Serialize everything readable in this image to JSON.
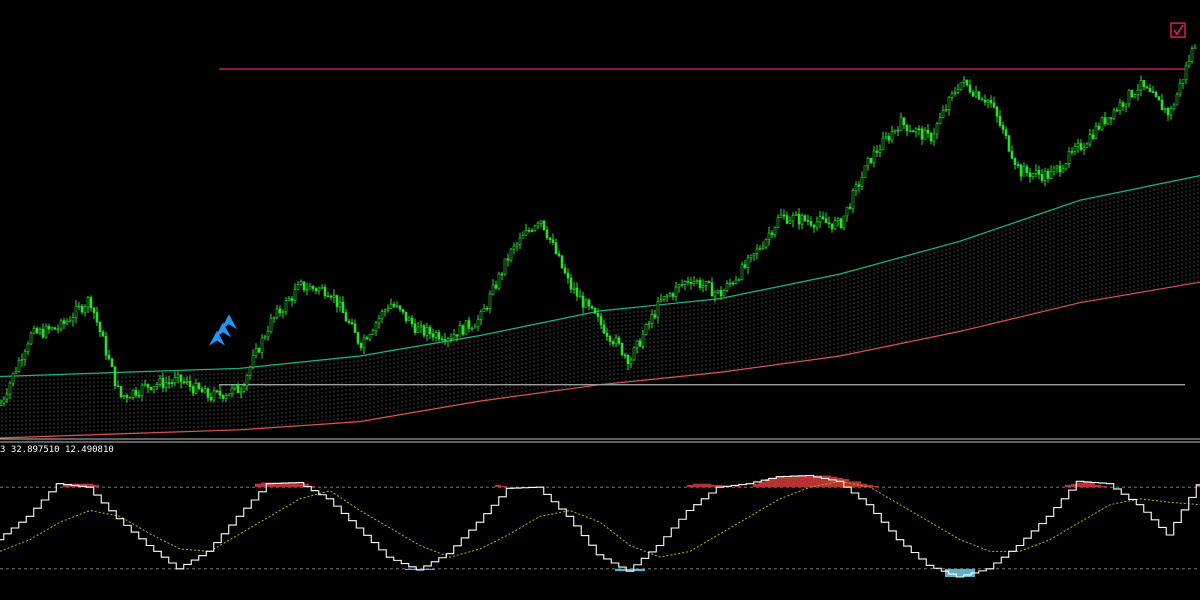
{
  "chart_data": [
    {
      "type": "line",
      "panel": "main",
      "title": "",
      "xlabel": "",
      "ylabel": "",
      "xlim": [
        0,
        200
      ],
      "ylim": [
        0,
        100
      ],
      "grid": false,
      "legend": "none",
      "series": [
        {
          "kind": "price-candles",
          "color": "#2ddc2d",
          "x": [
            0,
            5,
            10,
            15,
            20,
            25,
            30,
            35,
            40,
            45,
            50,
            55,
            60,
            65,
            70,
            75,
            80,
            85,
            90,
            95,
            100,
            105,
            110,
            115,
            120,
            125,
            130,
            135,
            140,
            145,
            150,
            155,
            160,
            165,
            170,
            175,
            180,
            185,
            190,
            195,
            200
          ],
          "y": [
            8,
            25,
            27,
            34,
            10,
            13,
            14,
            10,
            12,
            28,
            37,
            36,
            23,
            33,
            26,
            25,
            29,
            45,
            54,
            37,
            28,
            19,
            33,
            39,
            35,
            43,
            54,
            53,
            52,
            68,
            77,
            73,
            87,
            82,
            65,
            64,
            71,
            79,
            86,
            79,
            100
          ]
        },
        {
          "kind": "upper-band",
          "color": "#1fb27a",
          "x": [
            0,
            20,
            40,
            60,
            80,
            100,
            120,
            140,
            160,
            180,
            200
          ],
          "y": [
            15,
            16,
            17,
            20,
            25,
            31,
            34,
            40,
            48,
            58,
            64
          ]
        },
        {
          "kind": "lower-band",
          "color": "#d9534f",
          "x": [
            0,
            20,
            40,
            60,
            80,
            100,
            120,
            140,
            160,
            180,
            200
          ],
          "y": [
            0,
            1,
            2,
            4,
            9,
            13,
            16,
            20,
            26,
            33,
            38
          ]
        },
        {
          "kind": "resistance-level",
          "color": "#c2185b",
          "x": [
            36.5,
            197.5
          ],
          "y": [
            90,
            90
          ]
        },
        {
          "kind": "support-level",
          "color": "#9e9e9e",
          "x": [
            36.5,
            197.5
          ],
          "y": [
            13,
            13
          ]
        }
      ],
      "markers": [
        {
          "kind": "buy-arrow",
          "color": "#2196f3",
          "x": [
            36,
            37,
            38
          ],
          "y": [
            24,
            26,
            28
          ]
        },
        {
          "kind": "signal-checkbox",
          "color": "#e91e63",
          "x": [
            198
          ],
          "y": [
            99
          ]
        }
      ]
    },
    {
      "type": "line",
      "panel": "oscillator",
      "readout": "3 32.897510 12.490810",
      "xlim": [
        0,
        200
      ],
      "ylim": [
        -60,
        60
      ],
      "levels": [
        35,
        -35
      ],
      "level_color": "#8a8a8a",
      "series": [
        {
          "kind": "oscillator-steps",
          "color": "#ffffff",
          "x": [
            0,
            5,
            10,
            15,
            20,
            25,
            30,
            35,
            40,
            45,
            50,
            55,
            60,
            65,
            70,
            75,
            80,
            85,
            90,
            95,
            100,
            105,
            110,
            115,
            120,
            125,
            130,
            135,
            140,
            145,
            150,
            155,
            160,
            165,
            170,
            175,
            180,
            185,
            190,
            195,
            200
          ],
          "y": [
            -10,
            10,
            38,
            35,
            8,
            -15,
            -35,
            -20,
            10,
            38,
            39,
            25,
            0,
            -25,
            -36,
            -22,
            5,
            34,
            35,
            10,
            -23,
            -37,
            -15,
            15,
            35,
            38,
            44,
            45,
            40,
            20,
            -10,
            -32,
            -42,
            -35,
            -15,
            10,
            40,
            38,
            20,
            -6,
            37
          ]
        },
        {
          "kind": "signal-line",
          "color": "#b8b800",
          "x": [
            0,
            5,
            10,
            15,
            20,
            25,
            30,
            35,
            40,
            45,
            50,
            55,
            60,
            65,
            70,
            75,
            80,
            85,
            90,
            95,
            100,
            105,
            110,
            115,
            120,
            125,
            130,
            135,
            140,
            145,
            150,
            155,
            160,
            165,
            170,
            175,
            180,
            185,
            190,
            195,
            200
          ],
          "y": [
            -20,
            -10,
            5,
            15,
            10,
            -5,
            -18,
            -20,
            -5,
            10,
            25,
            32,
            15,
            0,
            -15,
            -25,
            -18,
            -5,
            10,
            15,
            5,
            -15,
            -25,
            -20,
            -5,
            10,
            25,
            35,
            40,
            35,
            20,
            5,
            -10,
            -20,
            -20,
            -10,
            5,
            20,
            25,
            22,
            20
          ]
        },
        {
          "kind": "overbought-fill",
          "color": "#b83232",
          "x": [
            10,
            11,
            12,
            13,
            14,
            15,
            16,
            17,
            42,
            43,
            44,
            45,
            46,
            47,
            48,
            49,
            50,
            51,
            52,
            82,
            83,
            84,
            114,
            115,
            116,
            117,
            118,
            119,
            120,
            121,
            122,
            123,
            126,
            127,
            128,
            129,
            130,
            131,
            132,
            133,
            134,
            135,
            136,
            137,
            138,
            139,
            140,
            141,
            142,
            143,
            144,
            145,
            146,
            147,
            148,
            177,
            178,
            179,
            180,
            181,
            182,
            183,
            184,
            199,
            200
          ],
          "y": [
            35,
            37,
            38,
            38,
            38,
            38,
            37,
            35,
            35,
            38,
            39,
            39,
            39,
            39,
            39,
            39,
            39,
            38,
            36,
            35,
            37,
            36,
            35,
            37,
            38,
            38,
            38,
            37,
            37,
            35,
            35,
            36,
            38,
            40,
            42,
            43,
            44,
            44,
            45,
            45,
            45,
            45,
            45,
            45,
            45,
            44,
            43,
            42,
            40,
            40,
            38,
            37,
            36,
            35,
            35,
            35,
            37,
            38,
            39,
            40,
            39,
            37,
            36,
            35,
            37
          ]
        }
      ]
    }
  ]
}
